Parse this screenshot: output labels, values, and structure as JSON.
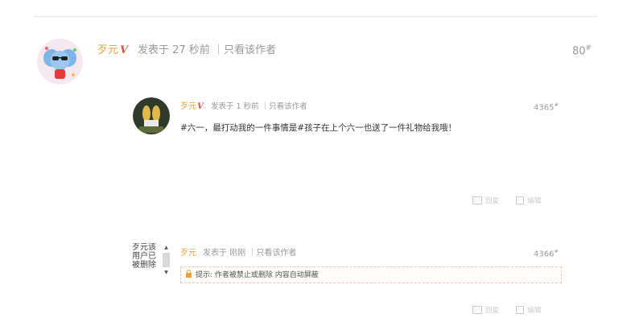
{
  "post_main": {
    "author": "歹元",
    "verified_mark": "V",
    "meta": "发表于 27 秒前 ｜只看该作者",
    "floor": "80",
    "floor_suffix": "#"
  },
  "reply_1": {
    "author": "歹元",
    "verified_mark": "V",
    "meta": "发表于 1 秒前 ｜只看该作者",
    "floor": "4365",
    "floor_suffix": "#",
    "content": "#六一，最打动我的一件事情是#孩子在上个六一也送了一件礼物给我哦！",
    "actions": {
      "reply_label": "回复",
      "edit_label": "编辑"
    }
  },
  "reply_2": {
    "deleted_user_text": "歹元该用户已被删除",
    "author": "歹元",
    "meta": "发表于 刚刚 ｜只看该作者",
    "floor": "4366",
    "floor_suffix": "#",
    "tip_label": "提示:",
    "tip_text": "作者被禁止或删除 内容自动屏蔽",
    "actions": {
      "reply_label": "回复",
      "edit_label": "编辑"
    }
  },
  "colors": {
    "author": "#e8a33c",
    "verified": "#d9534f",
    "meta": "#999999"
  }
}
